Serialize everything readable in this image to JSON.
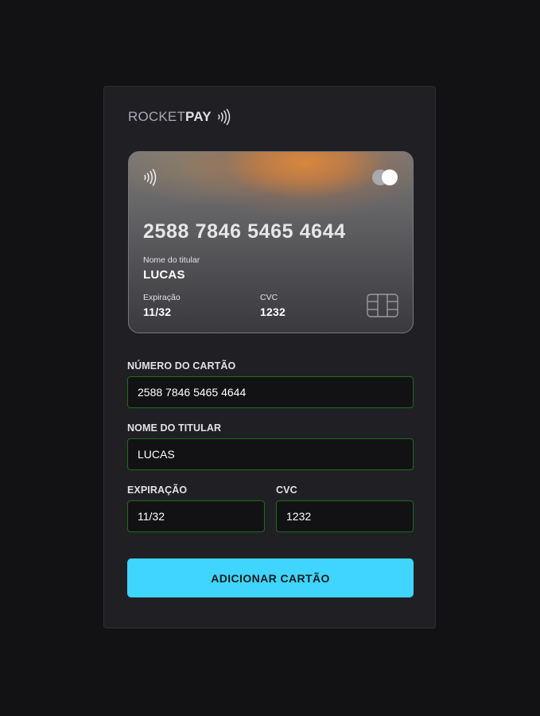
{
  "brand": {
    "name_part1": "ROCKET",
    "name_part2": "PAY",
    "icon": "contactless-icon"
  },
  "card_preview": {
    "contactless_icon": "contactless-icon",
    "brand_icon": "card-brand-toggle-icon",
    "chip_icon": "chip-icon",
    "number": "2588 7846 5465 4644",
    "holder_label": "Nome do titular",
    "holder_value": "LUCAS",
    "expiration_label": "Expiração",
    "expiration_value": "11/32",
    "cvc_label": "CVC",
    "cvc_value": "1232"
  },
  "form": {
    "card_number": {
      "label": "NÚMERO DO CARTÃO",
      "value": "2588 7846 5465 4644"
    },
    "holder_name": {
      "label": "NOME DO TITULAR",
      "value": "LUCAS"
    },
    "expiration": {
      "label": "EXPIRAÇÃO",
      "value": "11/32"
    },
    "cvc": {
      "label": "CVC",
      "value": "1232"
    },
    "submit_label": "ADICIONAR CARTÃO"
  },
  "colors": {
    "page_bg": "#121214",
    "panel_bg": "#202024",
    "input_border": "#1d6b1d",
    "button_bg": "#3fd5fe",
    "card_accent": "#de883a"
  }
}
